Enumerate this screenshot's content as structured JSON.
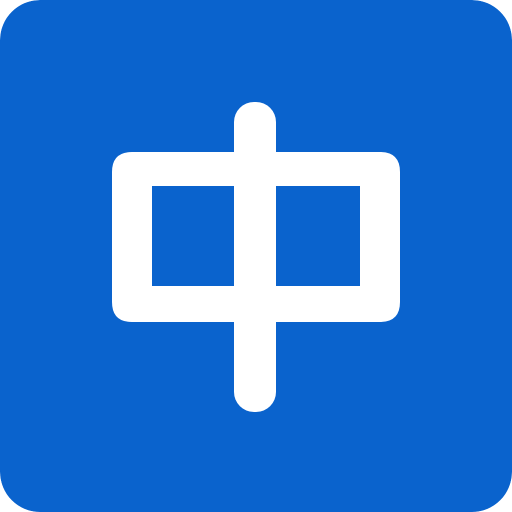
{
  "icon": {
    "name": "chinese-character-zhong-icon",
    "glyph": "中",
    "background_color": "#0A63CD",
    "foreground_color": "#FFFFFF"
  }
}
